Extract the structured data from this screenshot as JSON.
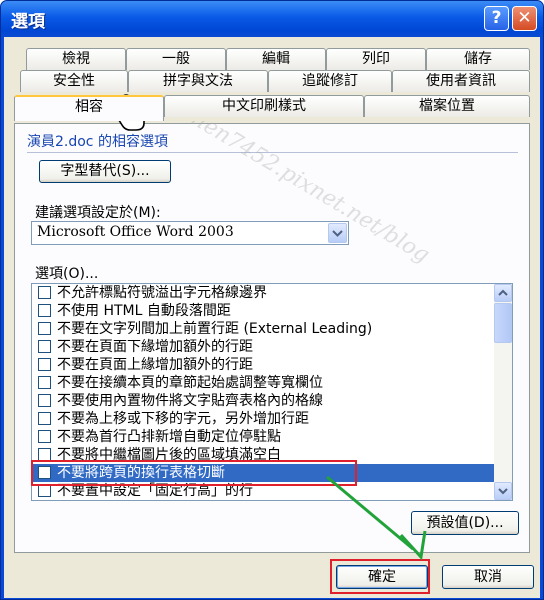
{
  "window": {
    "title": "選項",
    "help_glyph": "?",
    "close_glyph": "✕"
  },
  "tabs": {
    "row1": [
      "檢視",
      "一般",
      "編輯",
      "列印",
      "儲存"
    ],
    "row2": [
      "安全性",
      "拼字與文法",
      "追蹤修訂",
      "使用者資訊"
    ],
    "row3": [
      "相容",
      "中文印刷樣式",
      "檔案位置"
    ],
    "active": "相容"
  },
  "panel": {
    "heading": "演員2.doc 的相容選項",
    "font_sub_button": "字型替代(S)...",
    "recommend_label": "建議選項設定於(M):",
    "recommend_value": "Microsoft Office Word 2003",
    "options_label": "選項(O)...",
    "options": [
      {
        "label": "不允許標點符號溢出字元格線邊界",
        "checked": false,
        "selected": false
      },
      {
        "label": "不使用 HTML 自動段落間距",
        "checked": false,
        "selected": false
      },
      {
        "label": "不要在文字列間加上前置行距 (External Leading)",
        "checked": false,
        "selected": false
      },
      {
        "label": "不要在頁面下緣增加額外的行距",
        "checked": false,
        "selected": false
      },
      {
        "label": "不要在頁面上緣增加額外的行距",
        "checked": false,
        "selected": false
      },
      {
        "label": "不要在接續本頁的章節起始處調整等寬欄位",
        "checked": false,
        "selected": false
      },
      {
        "label": "不要使用內置物件將文字貼齊表格內的格線",
        "checked": false,
        "selected": false
      },
      {
        "label": "不要為上移或下移的字元，另外增加行距",
        "checked": false,
        "selected": false
      },
      {
        "label": "不要為首行凸排新增自動定位停駐點",
        "checked": false,
        "selected": false
      },
      {
        "label": "不要將中繼檔圖片後的區域填滿空白",
        "checked": false,
        "selected": false
      },
      {
        "label": "不要將跨頁的換行表格切斷",
        "checked": false,
        "selected": true
      },
      {
        "label": "不要置中設定「固定行高」的行",
        "checked": false,
        "selected": false
      }
    ],
    "default_button": "預設值(D)..."
  },
  "footer": {
    "ok_button": "確定",
    "cancel_button": "取消"
  },
  "watermark_text": "http://chen7452.pixnet.net/blog",
  "colors": {
    "title_bar": "#0a5ae6",
    "selection": "#316ac5",
    "highlight": "#e0202a",
    "arrow": "#22a33a"
  }
}
